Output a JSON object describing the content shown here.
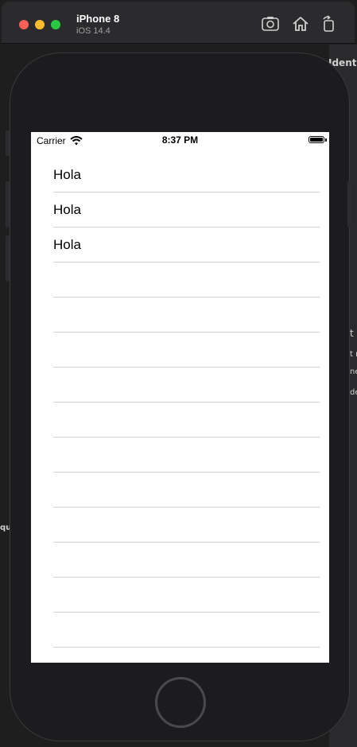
{
  "window": {
    "device_name": "iPhone 8",
    "os_version": "iOS 14.4",
    "toolbar": [
      {
        "icon": "screenshot-icon"
      },
      {
        "icon": "home-icon"
      },
      {
        "icon": "rotate-icon"
      }
    ]
  },
  "background": {
    "partial_labels": [
      "Ident",
      "t",
      "t r",
      "ne",
      "de",
      "qu"
    ]
  },
  "status_bar": {
    "carrier": "Carrier",
    "time": "8:37 PM"
  },
  "table": {
    "rows": [
      {
        "label": "Hola"
      },
      {
        "label": "Hola"
      },
      {
        "label": "Hola"
      },
      {
        "label": ""
      },
      {
        "label": ""
      },
      {
        "label": ""
      },
      {
        "label": ""
      },
      {
        "label": ""
      },
      {
        "label": ""
      },
      {
        "label": ""
      },
      {
        "label": ""
      },
      {
        "label": ""
      },
      {
        "label": ""
      },
      {
        "label": ""
      }
    ]
  },
  "colors": {
    "close": "#ff5f57",
    "minimize": "#febc2e",
    "zoom": "#28c840",
    "separator": "#d1d1d6"
  }
}
